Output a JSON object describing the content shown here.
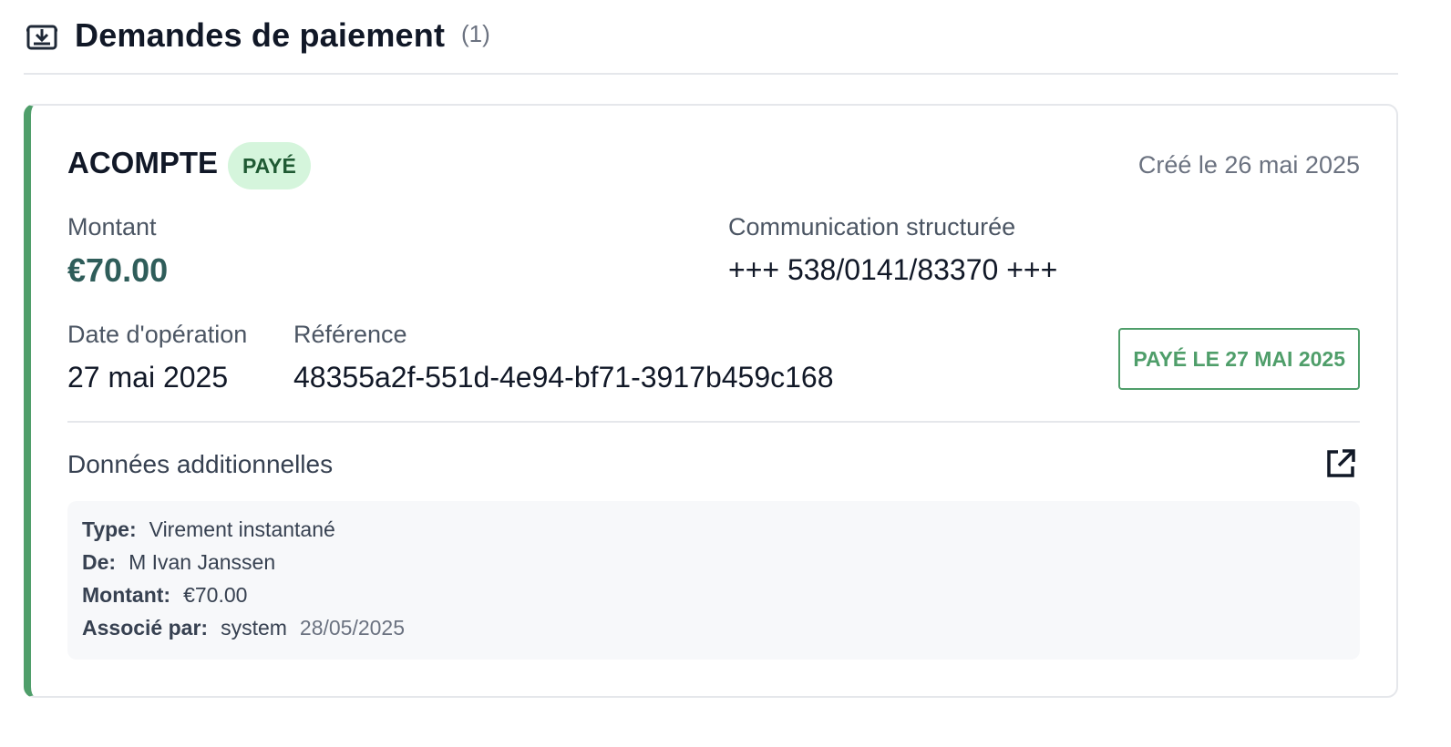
{
  "header": {
    "title": "Demandes de paiement",
    "count": "(1)",
    "icon": "inbox-download-icon"
  },
  "payment": {
    "type": "ACOMPTE",
    "status": "PAYÉ",
    "created": "Créé le 26 mai 2025",
    "amount_label": "Montant",
    "amount": "€70.00",
    "communication_label": "Communication structurée",
    "communication": "+++ 538/0141/83370 +++",
    "operation_date_label": "Date d'opération",
    "operation_date": "27 mai 2025",
    "reference_label": "Référence",
    "reference": "48355a2f-551d-4e94-bf71-3917b459c168",
    "paid_button": "PAYÉ LE 27 MAI 2025"
  },
  "additional": {
    "title": "Données additionnelles",
    "link_icon": "external-link-icon",
    "rows": [
      {
        "key": "Type:",
        "value": "Virement instantané"
      },
      {
        "key": "De:",
        "value": "M Ivan Janssen"
      },
      {
        "key": "Montant:",
        "value": "€70.00"
      },
      {
        "key": "Associé par:",
        "value": "system",
        "extra": "28/05/2025"
      }
    ]
  },
  "colors": {
    "accent": "#4f9e6a",
    "badge_bg": "#d5f5dc",
    "amount": "#2f5d5a"
  }
}
